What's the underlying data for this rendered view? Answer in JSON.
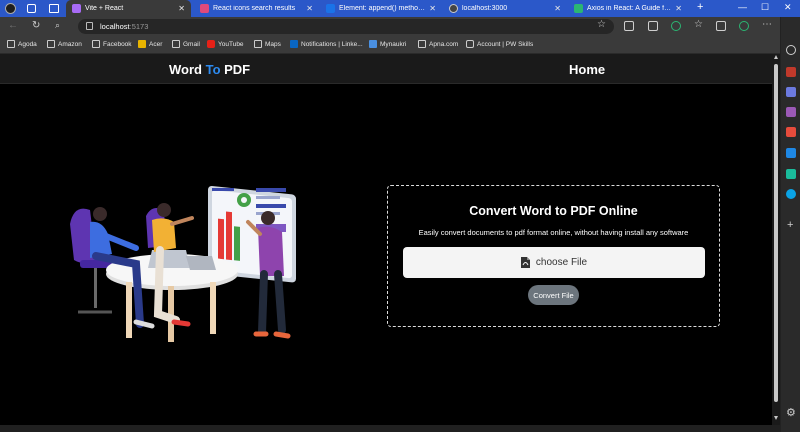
{
  "tabs": [
    {
      "title": "",
      "favicon_color": "#888888",
      "active": false,
      "close": ""
    },
    {
      "title": "Vite + React",
      "favicon_color": "#a86bf5",
      "active": true,
      "close": "✕"
    },
    {
      "title": "React icons search results",
      "favicon_color": "#e04a7a",
      "active": false,
      "close": "✕"
    },
    {
      "title": "Element: append() method - We",
      "favicon_color": "#1a73e8",
      "active": false,
      "close": "✕"
    },
    {
      "title": "localhost:3000",
      "favicon_color": "#444444",
      "active": false,
      "close": "✕"
    },
    {
      "title": "Axios in React: A Guide for Begi",
      "favicon_color": "#2bb673",
      "active": false,
      "close": "✕"
    }
  ],
  "new_tab": "+",
  "window": {
    "minimize": "—",
    "maximize": "☐",
    "close": "✕"
  },
  "address": {
    "host": "localhost",
    "port": ":5173"
  },
  "bookmarks": [
    {
      "label": "Agoda",
      "color": "#d0d0d0"
    },
    {
      "label": "Amazon",
      "color": "#d0d0d0"
    },
    {
      "label": "Facebook",
      "color": "#d0d0d0"
    },
    {
      "label": "Acer",
      "color": "#e8b400"
    },
    {
      "label": "Gmail",
      "color": "#d0d0d0"
    },
    {
      "label": "YouTube",
      "color": "#e62117"
    },
    {
      "label": "Maps",
      "color": "#d0d0d0"
    },
    {
      "label": "Notifications | Linke...",
      "color": "#0a66c2"
    },
    {
      "label": "Mynaukri",
      "color": "#4a90e2"
    },
    {
      "label": "Apna.com",
      "color": "#d0d0d0"
    },
    {
      "label": "Account | PW Skills",
      "color": "#d0d0d0"
    }
  ],
  "app": {
    "brand_word": "Word ",
    "brand_to": "To",
    "brand_pdf": " PDF",
    "home": "Home"
  },
  "card": {
    "title": "Convert Word to PDF Online",
    "subtitle": "Easily convert documents to pdf format online, without having install any software",
    "choose_label": "choose File",
    "convert_label": "Convert File"
  },
  "colors": {
    "accent": "#2d8bf0",
    "tabstrip": "#2b58c9",
    "button_gray": "#6c757d"
  }
}
